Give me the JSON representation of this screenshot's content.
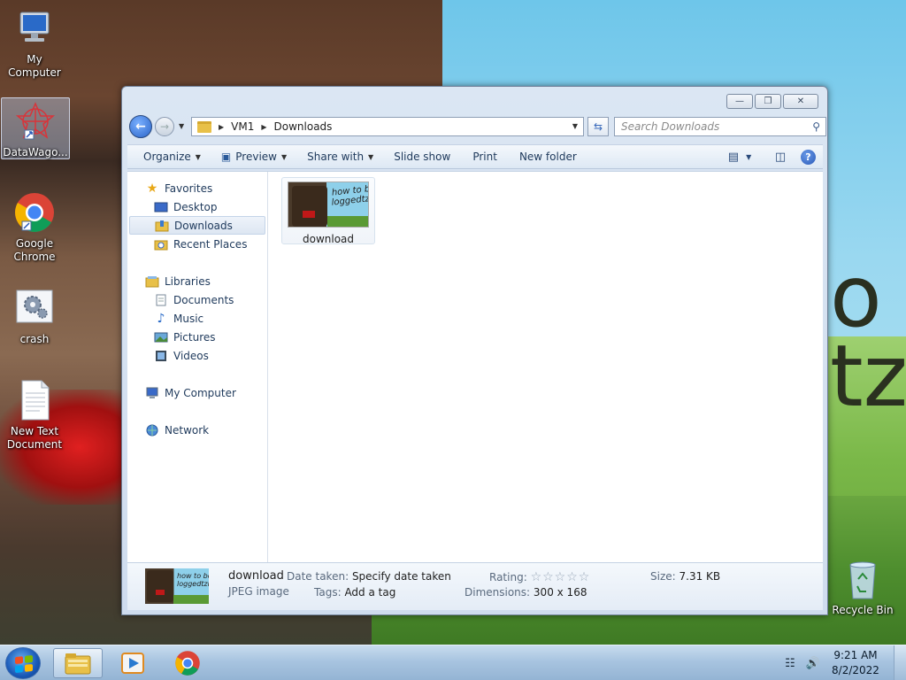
{
  "desktop": {
    "icons": [
      {
        "label": "My Computer",
        "icon": "computer-icon"
      },
      {
        "label": "DataWago...",
        "icon": "datawagon-icon"
      },
      {
        "label": "Google Chrome",
        "icon": "chrome-icon"
      },
      {
        "label": "crash",
        "icon": "settings-file-icon"
      },
      {
        "label": "New Text Document",
        "icon": "text-file-icon"
      },
      {
        "label": "Recycle Bin",
        "icon": "recycle-bin-icon"
      }
    ]
  },
  "window": {
    "breadcrumb": [
      "VM1",
      "Downloads"
    ],
    "search_placeholder": "Search Downloads",
    "toolbar": {
      "organize": "Organize",
      "preview": "Preview",
      "share_with": "Share with",
      "slide_show": "Slide show",
      "print": "Print",
      "new_folder": "New folder"
    },
    "nav": {
      "favorites": "Favorites",
      "desktop": "Desktop",
      "downloads": "Downloads",
      "recent_places": "Recent Places",
      "libraries": "Libraries",
      "documents": "Documents",
      "music": "Music",
      "pictures": "Pictures",
      "videos": "Videos",
      "my_computer": "My Computer",
      "network": "Network"
    },
    "files": [
      {
        "name": "download",
        "thumb_text": "how to be loggedtzip"
      }
    ],
    "details": {
      "name": "download",
      "type": "JPEG image",
      "date_taken_label": "Date taken:",
      "date_taken_value": "Specify date taken",
      "tags_label": "Tags:",
      "tags_value": "Add a tag",
      "rating_label": "Rating:",
      "rating_stars": 0,
      "dimensions_label": "Dimensions:",
      "dimensions_value": "300 x 168",
      "size_label": "Size:",
      "size_value": "7.31 KB"
    }
  },
  "taskbar": {
    "time": "9:21 AM",
    "date": "8/2/2022"
  },
  "colors": {
    "accent": "#1e395b",
    "taskbar": "#a8c4e0"
  }
}
